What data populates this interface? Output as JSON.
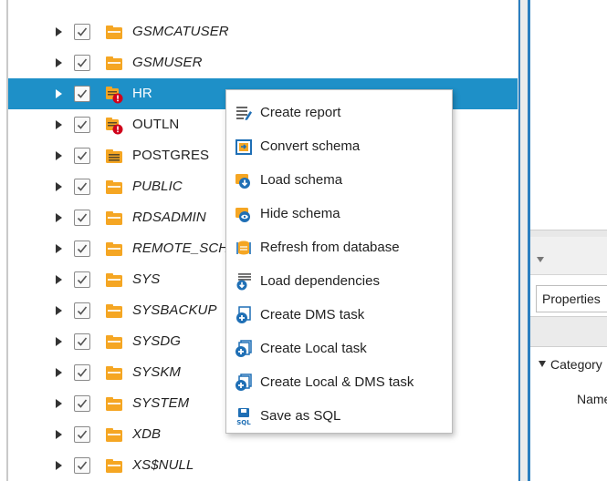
{
  "tree": {
    "items": [
      {
        "label": "GSMCATUSER",
        "italic": true,
        "icon": "schema-folder-icon",
        "selected": false
      },
      {
        "label": "GSMUSER",
        "italic": true,
        "icon": "schema-folder-icon",
        "selected": false
      },
      {
        "label": "HR",
        "italic": false,
        "icon": "schema-warning-icon",
        "selected": true
      },
      {
        "label": "OUTLN",
        "italic": false,
        "icon": "schema-warning-icon",
        "selected": false
      },
      {
        "label": "POSTGRES",
        "italic": false,
        "icon": "schema-list-icon",
        "selected": false
      },
      {
        "label": "PUBLIC",
        "italic": true,
        "icon": "schema-folder-icon",
        "selected": false
      },
      {
        "label": "RDSADMIN",
        "italic": true,
        "icon": "schema-folder-icon",
        "selected": false
      },
      {
        "label": "REMOTE_SCHEDULER_AGENT",
        "italic": true,
        "icon": "schema-folder-icon",
        "selected": false
      },
      {
        "label": "SYS",
        "italic": true,
        "icon": "schema-folder-icon",
        "selected": false
      },
      {
        "label": "SYSBACKUP",
        "italic": true,
        "icon": "schema-folder-icon",
        "selected": false
      },
      {
        "label": "SYSDG",
        "italic": true,
        "icon": "schema-folder-icon",
        "selected": false
      },
      {
        "label": "SYSKM",
        "italic": true,
        "icon": "schema-folder-icon",
        "selected": false
      },
      {
        "label": "SYSTEM",
        "italic": true,
        "icon": "schema-folder-icon",
        "selected": false
      },
      {
        "label": "XDB",
        "italic": true,
        "icon": "schema-folder-icon",
        "selected": false
      },
      {
        "label": "XS$NULL",
        "italic": true,
        "icon": "schema-folder-icon",
        "selected": false
      }
    ]
  },
  "context_menu": {
    "items": [
      {
        "label": "Create report",
        "icon": "report-icon"
      },
      {
        "label": "Convert schema",
        "icon": "convert-schema-icon"
      },
      {
        "label": "Load schema",
        "icon": "load-schema-icon"
      },
      {
        "label": "Hide schema",
        "icon": "hide-schema-icon"
      },
      {
        "label": "Refresh from database",
        "icon": "refresh-database-icon"
      },
      {
        "label": "Load dependencies",
        "icon": "load-dependencies-icon"
      },
      {
        "label": "Create DMS task",
        "icon": "create-dms-task-icon"
      },
      {
        "label": "Create Local task",
        "icon": "create-local-task-icon"
      },
      {
        "label": "Create Local & DMS task",
        "icon": "create-local-dms-task-icon"
      },
      {
        "label": "Save as SQL",
        "icon": "save-sql-icon"
      }
    ]
  },
  "properties": {
    "tab_label": "Properties",
    "category_label": "Category",
    "name_label": "Name"
  },
  "colors": {
    "selection": "#1e90c8",
    "folder": "#f5a623",
    "warning": "#d0021b",
    "splitter": "#2c7fc0",
    "icon_blue": "#1f6fb5"
  }
}
